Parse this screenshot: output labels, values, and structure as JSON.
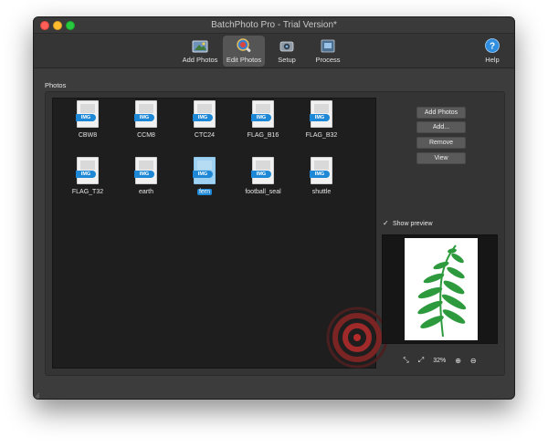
{
  "window": {
    "title": "BatchPhoto Pro - Trial Version*"
  },
  "toolbar": {
    "add_photos": "Add Photos",
    "edit_photos": "Edit Photos",
    "setup": "Setup",
    "process": "Process",
    "help": "Help",
    "active": "Edit Photos"
  },
  "photos_section": {
    "label": "Photos"
  },
  "photo_badge": "IMG",
  "photos": [
    {
      "name": "CBW8"
    },
    {
      "name": "CCM8"
    },
    {
      "name": "CTC24"
    },
    {
      "name": "FLAG_B16"
    },
    {
      "name": "FLAG_B32"
    },
    {
      "name": "FLAG_T32"
    },
    {
      "name": "earth"
    },
    {
      "name": "fern",
      "selected": true
    },
    {
      "name": "football_seal"
    },
    {
      "name": "shuttle"
    }
  ],
  "side_buttons": {
    "add_photos": "Add Photos",
    "add": "Add...",
    "remove": "Remove",
    "view": "View"
  },
  "preview": {
    "label": "Show preview",
    "checked": true
  },
  "zoom": {
    "level": "32%"
  },
  "colors": {
    "accent": "#1e88d6",
    "fern": "#2e9a3e",
    "swirl": "#b52a2a"
  }
}
